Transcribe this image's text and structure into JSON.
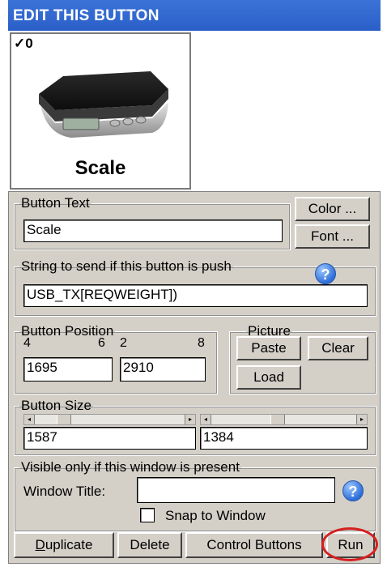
{
  "title": "EDIT THIS BUTTON",
  "preview": {
    "badge": "0",
    "check": "✓",
    "caption": "Scale"
  },
  "button_text": {
    "legend": "Button Text",
    "value": "Scale",
    "color_label": "Color ...",
    "font_label": "Font ..."
  },
  "string_send": {
    "legend": "String to send if this button is push",
    "value": "USB_TX[REQWEIGHT])"
  },
  "position": {
    "legend": "Button Position",
    "n1": "4",
    "n2": "6",
    "n3": "2",
    "n4": "8",
    "x": "1695",
    "y": "2910"
  },
  "picture": {
    "legend": "Picture",
    "paste": "Paste",
    "clear": "Clear",
    "load": "Load"
  },
  "size": {
    "legend": "Button Size",
    "w": "1587",
    "h": "1384"
  },
  "visible": {
    "legend": "Visible only if this window is present",
    "window_title_label": "Window Title:",
    "window_title_value": "",
    "snap_label": "Snap to Window"
  },
  "actions": {
    "duplicate": "Duplicate",
    "delete": "Delete",
    "control": "Control Buttons",
    "run": "Run"
  },
  "colors": {
    "titlebar": "#2a5fc7",
    "panel": "#d4d0c8",
    "run_highlight": "#d62020"
  }
}
